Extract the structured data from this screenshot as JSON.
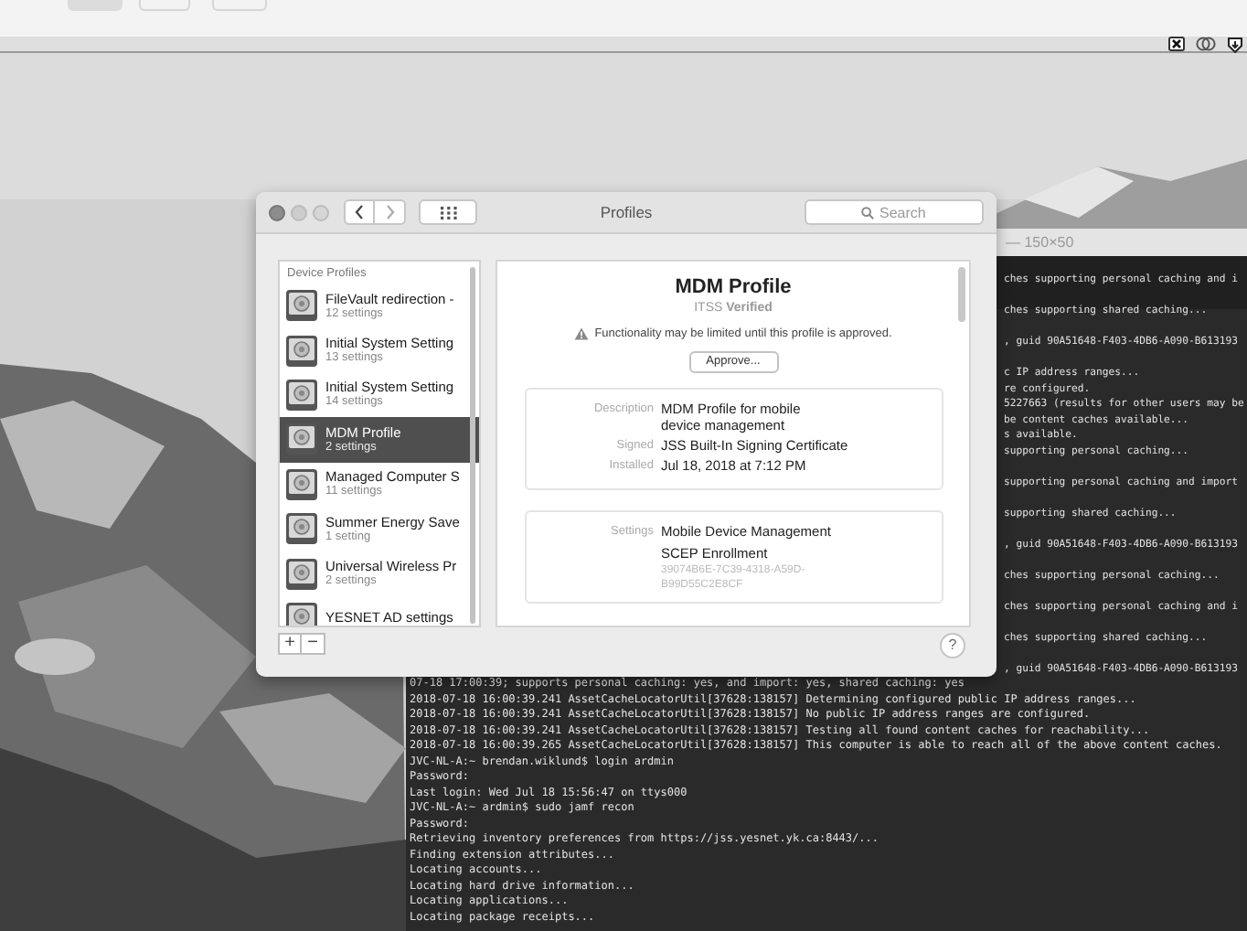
{
  "terminal": {
    "title": "— 150×50",
    "right_fragments": [
      [
        "ches supporting personal caching and i"
      ],
      [
        "ches supporting shared caching..."
      ],
      [
        ", guid 90A51648-F403-4DB6-A090-B613193"
      ],
      [
        "c IP address ranges...",
        "re configured.",
        "5227663 (results for other users may be",
        "be content caches available...",
        "s available.",
        "supporting personal caching..."
      ],
      [
        "supporting personal caching and import"
      ],
      [
        "supporting shared caching..."
      ],
      [
        ", guid 90A51648-F403-4DB6-A090-B613193"
      ],
      [
        "ches supporting personal caching..."
      ],
      [
        "ches supporting personal caching and i"
      ],
      [
        "ches supporting shared caching..."
      ],
      [
        ", guid 90A51648-F403-4DB6-A090-B613193"
      ]
    ],
    "lines": [
      "07-18 17:00:39; supports personal caching: yes, and import: yes, shared caching: yes",
      "2018-07-18 16:00:39.241 AssetCacheLocatorUtil[37628:138157] Determining configured public IP address ranges...",
      "2018-07-18 16:00:39.241 AssetCacheLocatorUtil[37628:138157] No public IP address ranges are configured.",
      "2018-07-18 16:00:39.241 AssetCacheLocatorUtil[37628:138157] Testing all found content caches for reachability...",
      "2018-07-18 16:00:39.265 AssetCacheLocatorUtil[37628:138157] This computer is able to reach all of the above content caches.",
      "JVC-NL-A:~ brendan.wiklund$ login ardmin",
      "Password:",
      "Last login: Wed Jul 18 15:56:47 on ttys000",
      "JVC-NL-A:~ ardmin$ sudo jamf recon",
      "Password:",
      "Retrieving inventory preferences from https://jss.yesnet.yk.ca:8443/...",
      "Finding extension attributes...",
      "Locating accounts...",
      "Locating hard drive information...",
      "Locating applications...",
      "Locating package receipts..."
    ]
  },
  "profiles_window": {
    "title": "Profiles",
    "search": {
      "placeholder": "Search"
    },
    "sidebar": {
      "header": "Device Profiles",
      "items": [
        {
          "name": "FileVault redirection -",
          "count": "12 settings",
          "selected": false
        },
        {
          "name": "Initial System Setting",
          "count": "13 settings",
          "selected": false
        },
        {
          "name": "Initial System Setting",
          "count": "14 settings",
          "selected": false
        },
        {
          "name": "MDM Profile",
          "count": "2 settings",
          "selected": true
        },
        {
          "name": "Managed Computer S",
          "count": "11 settings",
          "selected": false
        },
        {
          "name": "Summer Energy Save",
          "count": "1 setting",
          "selected": false
        },
        {
          "name": "Universal Wireless Pr",
          "count": "2 settings",
          "selected": false
        },
        {
          "name": "YESNET AD settings",
          "selected": false
        }
      ]
    },
    "add_button": "+",
    "remove_button": "−",
    "help_button": "?",
    "detail": {
      "title": "MDM Profile",
      "verification": "ITSS **Verified**",
      "warning": "Functionality may be limited until this profile is approved.",
      "approve_button": "Approve...",
      "info": [
        {
          "label": "Description",
          "value": [
            "MDM Profile for mobile",
            "device management"
          ]
        },
        {
          "label": "Signed",
          "value": [
            "JSS Built-In Signing Certificate"
          ]
        },
        {
          "label": "Installed",
          "value": [
            "Jul 18, 2018 at 7:12 PM"
          ]
        }
      ],
      "settings_label": "Settings",
      "payloads": [
        {
          "name": "Mobile Device Management"
        },
        {
          "name": "SCEP Enrollment",
          "identifier": [
            "39074B6E-7C39-4318-A59D-",
            "B99D55C2E8CF"
          ]
        }
      ]
    }
  }
}
